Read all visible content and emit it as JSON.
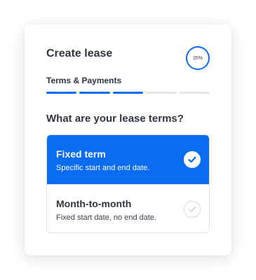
{
  "colors": {
    "accent": "#0a6cf0",
    "inactive_step": "#e4e6ea",
    "text": "#2f3640"
  },
  "header": {
    "title": "Create lease",
    "progress_label": "35%",
    "progress_fraction": 0.35
  },
  "section": {
    "subtitle": "Terms & Payments",
    "steps": [
      {
        "state": "complete"
      },
      {
        "state": "complete"
      },
      {
        "state": "complete"
      },
      {
        "state": "incomplete"
      },
      {
        "state": "incomplete"
      }
    ]
  },
  "question": "What are your lease terms?",
  "options": [
    {
      "title": "Fixed term",
      "description": "Specific start and end date.",
      "selected": true,
      "icon": "check-circle-icon"
    },
    {
      "title": "Month-to-month",
      "description": "Fixed start date, no end date.",
      "selected": false,
      "icon": "check-circle-outline-icon"
    }
  ]
}
